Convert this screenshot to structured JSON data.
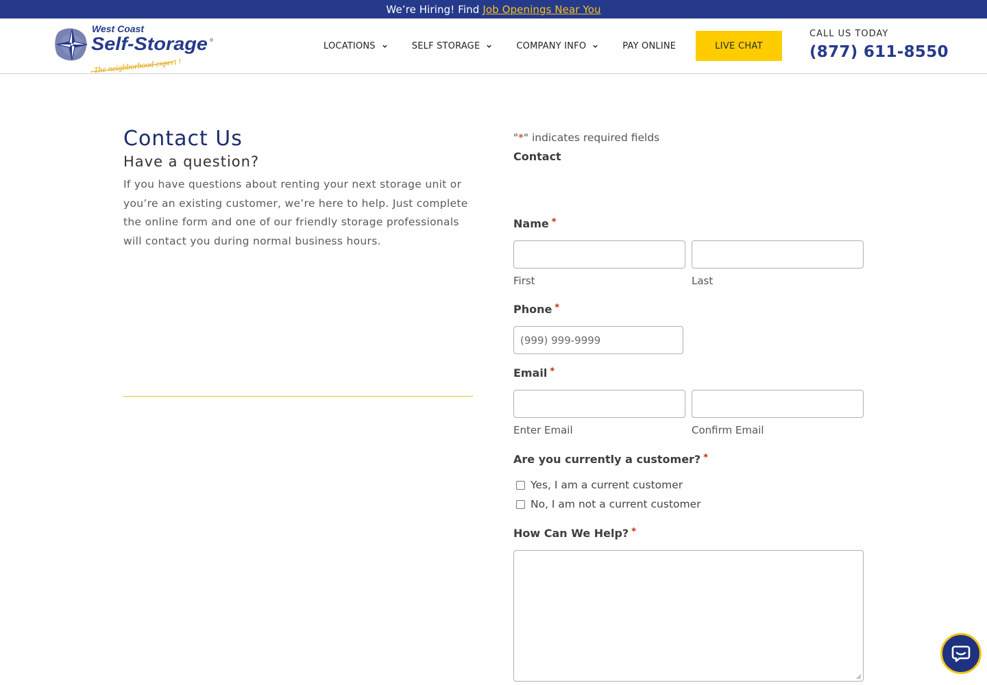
{
  "topbar": {
    "text": "We’re Hiring! Find",
    "link": "Job Openings Near You"
  },
  "header": {
    "logo": {
      "line1": "West Coast",
      "line2": "Self-Storage",
      "tagline": "The neighborhood expert !"
    },
    "nav": [
      {
        "label": "LOCATIONS",
        "has_dropdown": true
      },
      {
        "label": "SELF STORAGE",
        "has_dropdown": true
      },
      {
        "label": "COMPANY INFO",
        "has_dropdown": true
      },
      {
        "label": "PAY ONLINE",
        "has_dropdown": false
      }
    ],
    "live_chat": "LIVE CHAT",
    "call_label": "CALL US TODAY",
    "phone": "(877) 611-8550"
  },
  "intro": {
    "title": "Contact Us",
    "subtitle": "Have a question?",
    "body": "If you have questions about renting your next storage unit or you’re an existing customer, we’re here to help. Just complete the online form and one of our friendly storage professionals will contact you during normal business hours."
  },
  "form": {
    "required_note_star": "*",
    "required_note_open": "\"",
    "required_note_close": "\" indicates required fields",
    "title": "Contact",
    "required_star": "*",
    "name": {
      "label": "Name",
      "first_sub": "First",
      "last_sub": "Last",
      "first_value": "",
      "last_value": ""
    },
    "phone": {
      "label": "Phone",
      "placeholder": "(999) 999-9999",
      "value": ""
    },
    "email": {
      "label": "Email",
      "enter_sub": "Enter Email",
      "confirm_sub": "Confirm Email",
      "value": "",
      "confirm_value": ""
    },
    "customer": {
      "label": "Are you currently a customer?",
      "options": [
        "Yes, I am a current customer",
        "No, I am not a current customer"
      ]
    },
    "help": {
      "label": "How Can We Help?",
      "value": ""
    }
  },
  "colors": {
    "brand_navy": "#263a8c",
    "accent_yellow": "#ffcc00",
    "required_red": "#c02b0a"
  }
}
